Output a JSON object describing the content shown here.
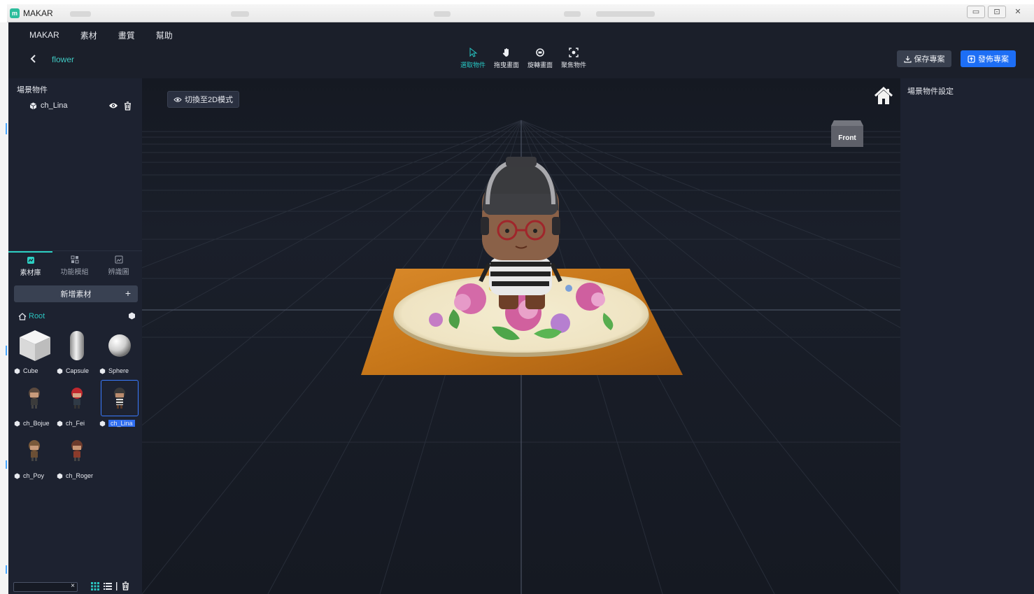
{
  "window": {
    "title": "MAKAR",
    "controls": {
      "minimize": "▭",
      "maximize": "⊡",
      "close": "✕"
    }
  },
  "menu": {
    "items": [
      "MAKAR",
      "素材",
      "畫質",
      "幫助"
    ]
  },
  "header": {
    "back_icon": "chevron-left-icon",
    "project_name": "flower",
    "tools": [
      {
        "label": "選取物件",
        "icon": "pointer-icon",
        "active": true
      },
      {
        "label": "拖曳畫面",
        "icon": "hand-icon",
        "active": false
      },
      {
        "label": "旋轉畫面",
        "icon": "rotate-view-icon",
        "active": false
      },
      {
        "label": "聚焦物件",
        "icon": "focus-icon",
        "active": false
      }
    ],
    "save_label": "保存專案",
    "publish_label": "發佈專案"
  },
  "scene_panel": {
    "title": "場景物件",
    "objects": [
      {
        "name": "ch_Lina"
      }
    ]
  },
  "asset_tabs": [
    {
      "label": "素材庫",
      "active": true
    },
    {
      "label": "功能模組",
      "active": false
    },
    {
      "label": "辨識圖",
      "active": false
    }
  ],
  "assets": {
    "add_label": "新增素材",
    "add_plus": "+",
    "root_label": "Root",
    "items": [
      {
        "name": "Cube",
        "kind": "cube",
        "selected": false
      },
      {
        "name": "Capsule",
        "kind": "capsule",
        "selected": false
      },
      {
        "name": "Sphere",
        "kind": "sphere",
        "selected": false
      },
      {
        "name": "ch_Bojue",
        "kind": "character",
        "selected": false
      },
      {
        "name": "ch_Fei",
        "kind": "character",
        "selected": false
      },
      {
        "name": "ch_Lina",
        "kind": "character",
        "selected": true
      },
      {
        "name": "ch_Poy",
        "kind": "character",
        "selected": false
      },
      {
        "name": "ch_Roger",
        "kind": "character",
        "selected": false
      }
    ],
    "search_value": "",
    "search_clear": "×"
  },
  "viewport": {
    "toggle_label": "切換至2D模式",
    "viewcube_label": "Front"
  },
  "properties_panel": {
    "title": "場景物件設定"
  },
  "colors": {
    "accent": "#27c6c3",
    "primary_button": "#1d6ef5",
    "panel_bg": "#1d2230",
    "viewport_bg": "#161a24"
  }
}
